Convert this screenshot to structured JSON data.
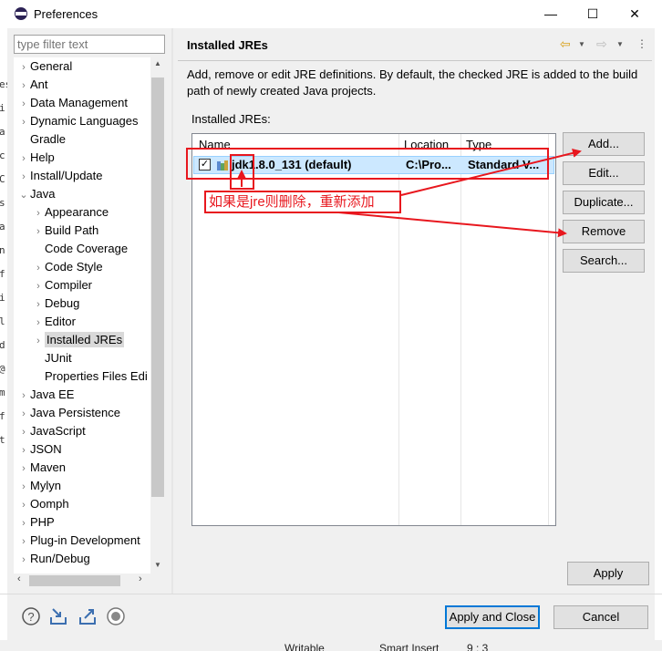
{
  "window": {
    "title": "Preferences",
    "minimize": "—",
    "maximize": "☐",
    "close": "✕"
  },
  "filter": {
    "placeholder": "type filter text"
  },
  "tree": [
    {
      "label": "General",
      "arrow": "›",
      "level": 0
    },
    {
      "label": "Ant",
      "arrow": "›",
      "level": 0
    },
    {
      "label": "Data Management",
      "arrow": "›",
      "level": 0
    },
    {
      "label": "Dynamic Languages",
      "arrow": "›",
      "level": 0
    },
    {
      "label": "Gradle",
      "arrow": "",
      "level": 0
    },
    {
      "label": "Help",
      "arrow": "›",
      "level": 0
    },
    {
      "label": "Install/Update",
      "arrow": "›",
      "level": 0
    },
    {
      "label": "Java",
      "arrow": "⌄",
      "level": 0
    },
    {
      "label": "Appearance",
      "arrow": "›",
      "level": 1
    },
    {
      "label": "Build Path",
      "arrow": "›",
      "level": 1
    },
    {
      "label": "Code Coverage",
      "arrow": "",
      "level": 1
    },
    {
      "label": "Code Style",
      "arrow": "›",
      "level": 1
    },
    {
      "label": "Compiler",
      "arrow": "›",
      "level": 1
    },
    {
      "label": "Debug",
      "arrow": "›",
      "level": 1
    },
    {
      "label": "Editor",
      "arrow": "›",
      "level": 1
    },
    {
      "label": "Installed JREs",
      "arrow": "›",
      "level": 1,
      "selected": true
    },
    {
      "label": "JUnit",
      "arrow": "",
      "level": 1
    },
    {
      "label": "Properties Files Edi",
      "arrow": "",
      "level": 1
    },
    {
      "label": "Java EE",
      "arrow": "›",
      "level": 0
    },
    {
      "label": "Java Persistence",
      "arrow": "›",
      "level": 0
    },
    {
      "label": "JavaScript",
      "arrow": "›",
      "level": 0
    },
    {
      "label": "JSON",
      "arrow": "›",
      "level": 0
    },
    {
      "label": "Maven",
      "arrow": "›",
      "level": 0
    },
    {
      "label": "Mylyn",
      "arrow": "›",
      "level": 0
    },
    {
      "label": "Oomph",
      "arrow": "›",
      "level": 0
    },
    {
      "label": "PHP",
      "arrow": "›",
      "level": 0
    },
    {
      "label": "Plug-in Development",
      "arrow": "›",
      "level": 0
    },
    {
      "label": "Run/Debug",
      "arrow": "›",
      "level": 0
    }
  ],
  "page": {
    "title": "Installed JREs",
    "description": "Add, remove or edit JRE definitions. By default, the checked JRE is added to the build path of newly created Java projects.",
    "list_label": "Installed JREs:"
  },
  "table": {
    "columns": [
      "Name",
      "Location",
      "Type"
    ],
    "rows": [
      {
        "checked": "✓",
        "name": "jdk1.8.0_131 (default)",
        "location": "C:\\Pro...",
        "type": "Standard V..."
      }
    ]
  },
  "buttons": {
    "add": "Add...",
    "edit": "Edit...",
    "duplicate": "Duplicate...",
    "remove": "Remove",
    "search": "Search...",
    "apply": "Apply",
    "apply_close": "Apply and Close",
    "cancel": "Cancel"
  },
  "annotation": {
    "text": "如果是jre则删除，重新添加",
    "color": "#e8171e"
  },
  "statusbar": {
    "writable": "Writable",
    "insert": "Smart Insert",
    "position": "9 : 3"
  },
  "icons": {
    "nav_back": "back-arrow-icon",
    "nav_forward": "forward-arrow-icon",
    "help": "help-icon",
    "import": "import-icon",
    "export": "export-icon",
    "record": "record-icon"
  }
}
